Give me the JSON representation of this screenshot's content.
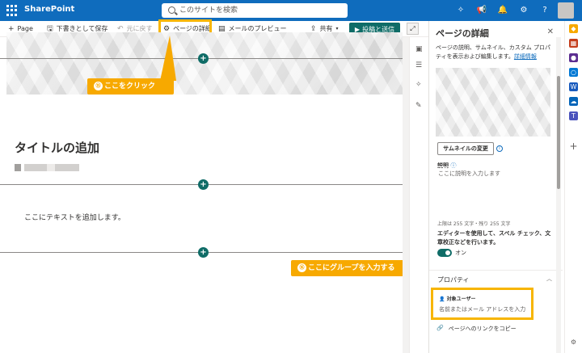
{
  "app": {
    "name": "SharePoint",
    "search_placeholder": "このサイトを検索"
  },
  "cmd": {
    "page": "Page",
    "save_draft": "下書きとして保存",
    "undo": "元に戻す",
    "page_details": "ページの詳細",
    "email_preview": "メールのプレビュー",
    "share": "共有",
    "publish": "投稿と送信"
  },
  "canvas": {
    "title": "タイトルの追加",
    "body": "ここにテキストを追加します。"
  },
  "callouts": {
    "c1_num": "⑮",
    "c1": "ここをクリック",
    "c2_num": "⑯",
    "c2": "ここにグループを入力する"
  },
  "panel": {
    "title": "ページの詳細",
    "desc": "ページの説明、サムネイル、カスタム プロパティを表示および編集します。",
    "details_link": "詳細情報",
    "change_thumb": "サムネイルの変更",
    "desc_label": "説明",
    "desc_placeholder": "ここに説明を入力します",
    "limit": "上限は 255 文字・残り 255 文字",
    "ai_text": "エディターを使用して、スペル チェック、文章校正などを行います。",
    "toggle_label": "オン",
    "properties": "プロパティ",
    "audience_label": "対象ユーザー",
    "audience_placeholder": "名前またはメール アドレスを入力",
    "copy_link": "ページへのリンクをコピー"
  },
  "colors": {
    "brand": "#0f6cbd",
    "publish": "#0f6c67",
    "callout": "#f7a900",
    "highlight": "#f7b500"
  }
}
